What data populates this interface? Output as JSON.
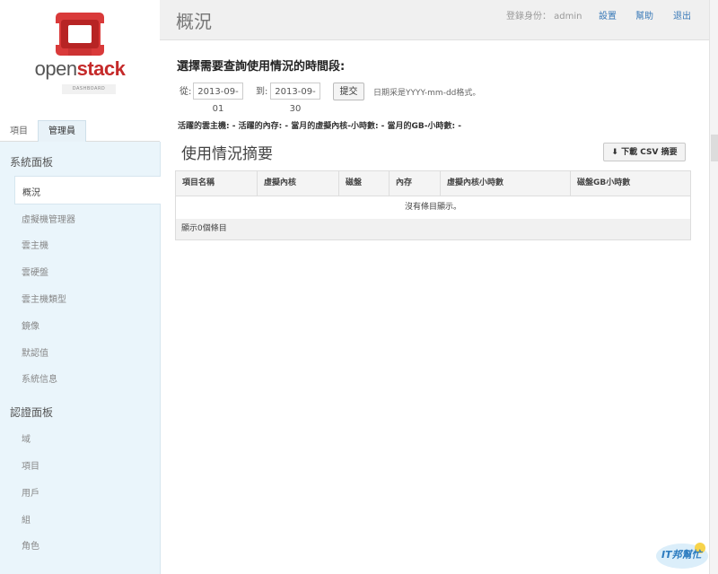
{
  "brand": {
    "name_a": "open",
    "name_b": "stack",
    "sub": "DASHBOARD"
  },
  "tabs": {
    "project": "項目",
    "admin": "管理員"
  },
  "sidebar": {
    "system_panel": "系統面板",
    "system_items": [
      "概況",
      "虛擬機管理器",
      "雲主機",
      "雲硬盤",
      "雲主機類型",
      "鏡像",
      "默認值",
      "系統信息"
    ],
    "auth_panel": "認證面板",
    "auth_items": [
      "域",
      "項目",
      "用戶",
      "組",
      "角色"
    ]
  },
  "header": {
    "title": "概況",
    "login_label": "登錄身份： admin",
    "settings": "設置",
    "help": "幫助",
    "logout": "退出"
  },
  "main": {
    "period_title": "選擇需要查詢使用情況的時間段:",
    "from_label": "從:",
    "from_value": "2013-09-01",
    "to_label": "到:",
    "to_value": "2013-09-30",
    "submit": "提交",
    "date_hint": "日期采是YYYY-mm-dd格式。",
    "stats": "活躍的雲主機: - 活躍的內存: - 當月的虛擬內核-小時數: - 當月的GB-小時數: -",
    "summary_title": "使用情況摘要",
    "csv_button": "下載 CSV 摘要",
    "table": {
      "columns": [
        "項目名稱",
        "虛擬內核",
        "磁盤",
        "內存",
        "虛擬內核小時數",
        "磁盤GB小時數"
      ],
      "empty": "沒有條目顯示。",
      "footer": "顯示0個條目"
    }
  },
  "watermark": "IT邦幫忙",
  "colors": {
    "brand_red": "#c52a2a",
    "link_blue": "#3a7ab8",
    "panel_bg": "#eaf5fb"
  }
}
